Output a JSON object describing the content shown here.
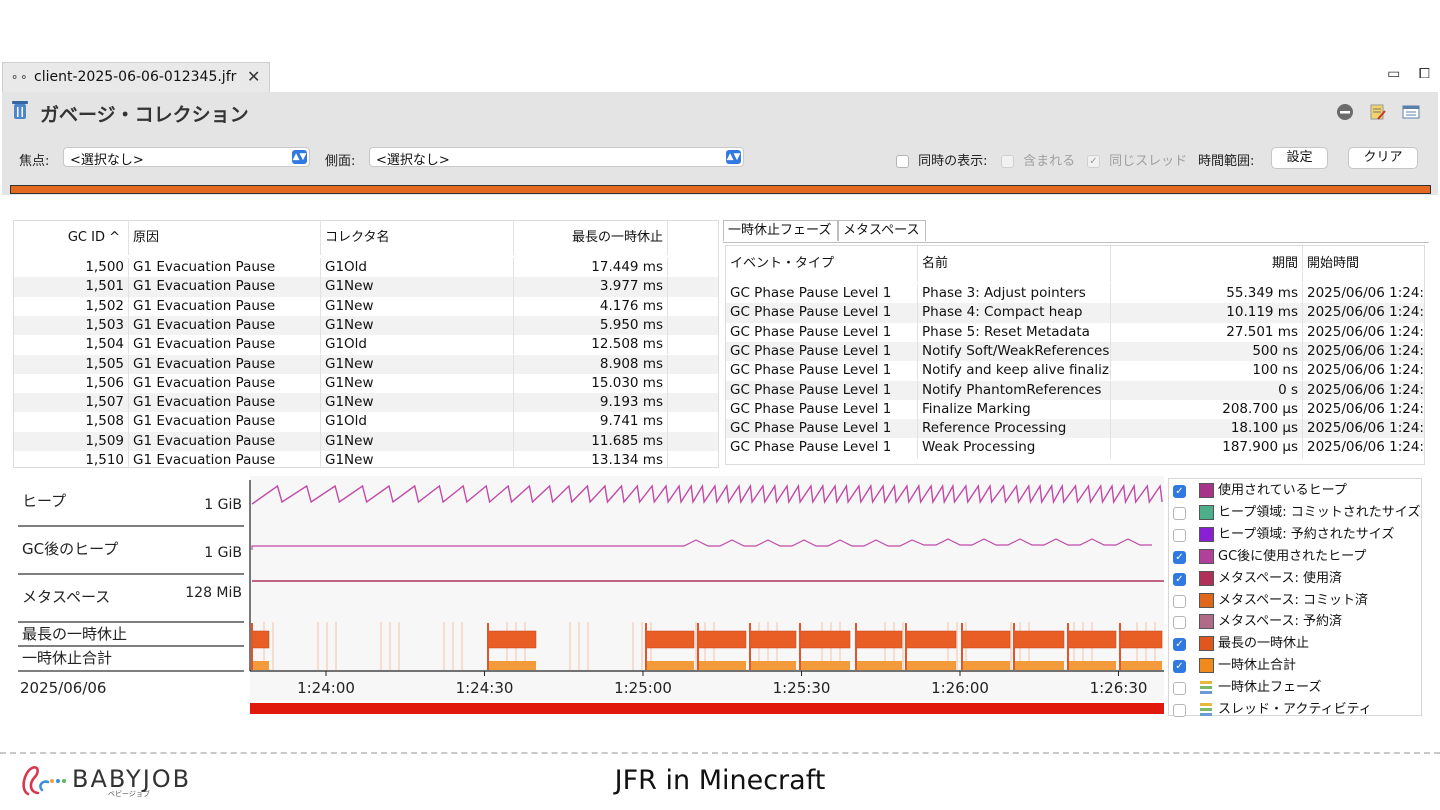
{
  "tab": {
    "title": "client-2025-06-06-012345.jfr",
    "close": "✕",
    "icon": "recording-icon"
  },
  "window_controls": {
    "minimize": "▭",
    "maximize": "⧠"
  },
  "page": {
    "title": "ガベージ・コレクション"
  },
  "filters": {
    "focus_label": "焦点:",
    "focus_value": "<選択なし>",
    "aspect_label": "側面:",
    "aspect_value": "<選択なし>",
    "concurrent_label": "同時の表示:",
    "concurrent_checked": false,
    "contained_label": "含まれる",
    "contained_checked": false,
    "same_thread_label": "同じスレッド",
    "same_thread_checked": true,
    "time_range_label": "時間範囲:",
    "set_button": "設定",
    "clear_button": "クリア"
  },
  "gc_table": {
    "columns": [
      "GC ID ^",
      "原因",
      "コレクタ名",
      "最長の一時休止"
    ],
    "rows": [
      [
        "1,500",
        "G1 Evacuation Pause",
        "G1Old",
        "17.449 ms"
      ],
      [
        "1,501",
        "G1 Evacuation Pause",
        "G1New",
        "3.977 ms"
      ],
      [
        "1,502",
        "G1 Evacuation Pause",
        "G1New",
        "4.176 ms"
      ],
      [
        "1,503",
        "G1 Evacuation Pause",
        "G1New",
        "5.950 ms"
      ],
      [
        "1,504",
        "G1 Evacuation Pause",
        "G1Old",
        "12.508 ms"
      ],
      [
        "1,505",
        "G1 Evacuation Pause",
        "G1New",
        "8.908 ms"
      ],
      [
        "1,506",
        "G1 Evacuation Pause",
        "G1New",
        "15.030 ms"
      ],
      [
        "1,507",
        "G1 Evacuation Pause",
        "G1New",
        "9.193 ms"
      ],
      [
        "1,508",
        "G1 Evacuation Pause",
        "G1Old",
        "9.741 ms"
      ],
      [
        "1,509",
        "G1 Evacuation Pause",
        "G1New",
        "11.685 ms"
      ],
      [
        "1,510",
        "G1 Evacuation Pause",
        "G1New",
        "13.134 ms"
      ]
    ]
  },
  "phase_tabs": [
    "一時休止フェーズ",
    "メタスペース"
  ],
  "phase_table": {
    "columns": [
      "イベント・タイプ",
      "名前",
      "期間",
      "開始時間"
    ],
    "rows": [
      [
        "GC Phase Pause Level 1",
        "Phase 3: Adjust pointers",
        "55.349 ms",
        "2025/06/06 1:24:"
      ],
      [
        "GC Phase Pause Level 1",
        "Phase 4: Compact heap",
        "10.119 ms",
        "2025/06/06 1:24:"
      ],
      [
        "GC Phase Pause Level 1",
        "Phase 5: Reset Metadata",
        "27.501 ms",
        "2025/06/06 1:24:"
      ],
      [
        "GC Phase Pause Level 1",
        "Notify Soft/WeakReferences",
        "500 ns",
        "2025/06/06 1:24:"
      ],
      [
        "GC Phase Pause Level 1",
        "Notify and keep alive finaliza",
        "100 ns",
        "2025/06/06 1:24:"
      ],
      [
        "GC Phase Pause Level 1",
        "Notify PhantomReferences",
        "0 s",
        "2025/06/06 1:24:"
      ],
      [
        "GC Phase Pause Level 1",
        "Finalize Marking",
        "208.700 µs",
        "2025/06/06 1:24:"
      ],
      [
        "GC Phase Pause Level 1",
        "Reference Processing",
        "18.100 µs",
        "2025/06/06 1:24:"
      ],
      [
        "GC Phase Pause Level 1",
        "Weak Processing",
        "187.900 µs",
        "2025/06/06 1:24:"
      ]
    ]
  },
  "chart": {
    "lanes": [
      {
        "label": "ヒープ",
        "scale": "1 GiB"
      },
      {
        "label": "GC後のヒープ",
        "scale": "1 GiB"
      },
      {
        "label": "メタスペース",
        "scale": "128 MiB"
      },
      {
        "label": "最長の一時休止",
        "scale": ""
      },
      {
        "label": "一時休止合計",
        "scale": ""
      }
    ],
    "date_label": "2025/06/06",
    "time_ticks": [
      "1:24:00",
      "1:24:30",
      "1:25:00",
      "1:25:30",
      "1:26:00",
      "1:26:30"
    ]
  },
  "legend": [
    {
      "label": "使用されているヒープ",
      "checked": true,
      "color": "#a8348a"
    },
    {
      "label": "ヒープ領域: コミットされたサイズ",
      "checked": false,
      "color": "#4caf8a"
    },
    {
      "label": "ヒープ領域: 予約されたサイズ",
      "checked": false,
      "color": "#8a1fd6"
    },
    {
      "label": "GC後に使用されたヒープ",
      "checked": true,
      "color": "#b0409a"
    },
    {
      "label": "メタスペース: 使用済",
      "checked": true,
      "color": "#b0305a"
    },
    {
      "label": "メタスペース: コミット済",
      "checked": false,
      "color": "#e0661c"
    },
    {
      "label": "メタスペース: 予約済",
      "checked": false,
      "color": "#b06a8a"
    },
    {
      "label": "最長の一時休止",
      "checked": true,
      "color": "#e0561c"
    },
    {
      "label": "一時休止合計",
      "checked": true,
      "color": "#f08a1c"
    },
    {
      "label": "一時休止フェーズ",
      "checked": false,
      "color": "stack-icon"
    },
    {
      "label": "スレッド・アクティビティ",
      "checked": false,
      "color": "stack-icon"
    }
  ],
  "footer": {
    "brand": "BABYJOB",
    "brand_sub": "ベビージョブ",
    "title": "JFR in Minecraft"
  }
}
